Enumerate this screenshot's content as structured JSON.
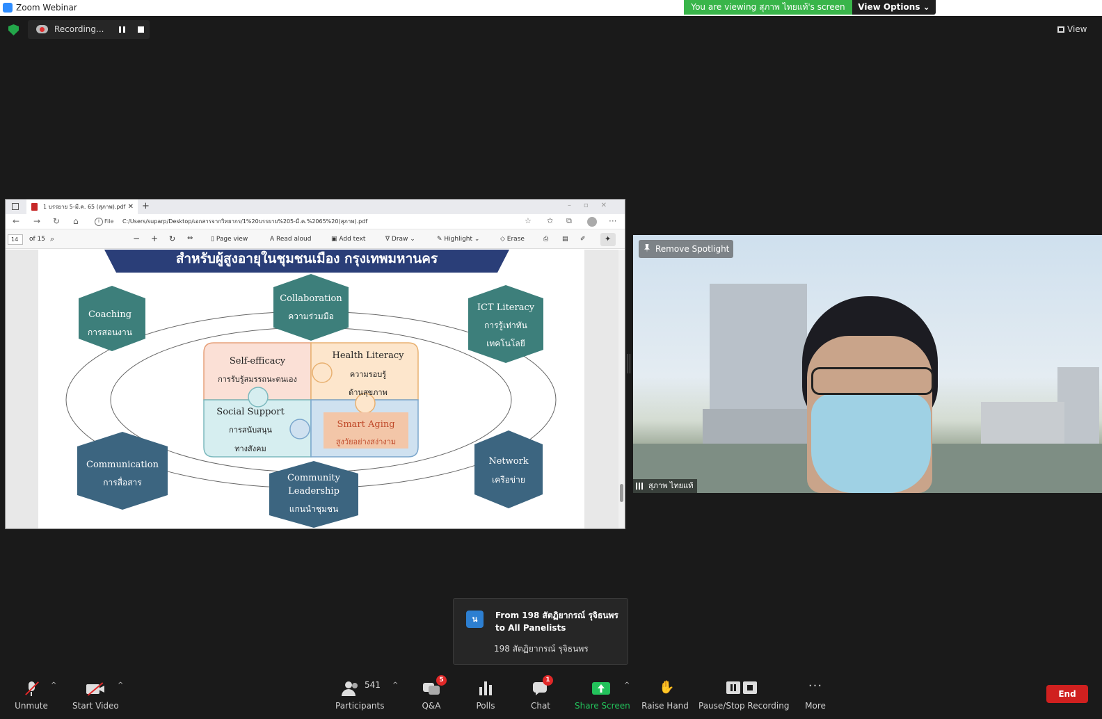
{
  "window": {
    "title": "Zoom Webinar"
  },
  "banner": {
    "viewing": "You are viewing สุภาพ ไทยแท้'s screen",
    "view_options": "View Options ⌄"
  },
  "recording": {
    "label": "Recording..."
  },
  "view_button": {
    "label": "View"
  },
  "browser": {
    "tab_title": "1 บรรยาย 5-มี.ค. 65 (สุภาพ).pdf",
    "file_tag": "File",
    "url": "C:/Users/suparp/Desktop/เอกสารจากวิทยากร/1%20บรรยาย%205-มี.ค.%2065%20(สุภาพ).pdf",
    "page_number": "14",
    "page_total": "of 15",
    "tools": {
      "page_view": "Page view",
      "read_aloud": "Read aloud",
      "add_text": "Add text",
      "draw": "Draw",
      "highlight": "Highlight",
      "erase": "Erase"
    }
  },
  "slide": {
    "heading": "สำหรับผู้สูงอายุในชุมชนเมือง กรุงเทพมหานคร",
    "hexes": [
      {
        "en": "Coaching",
        "th": "การสอนงาน"
      },
      {
        "en": "Collaboration",
        "th": "ความร่วมมือ"
      },
      {
        "en": "ICT Literacy",
        "th": "การรู้เท่าทัน",
        "th2": "เทคโนโลยี"
      },
      {
        "en": "Communication",
        "th": "การสื่อสาร"
      },
      {
        "en": "Community",
        "en2": "Leadership",
        "th": "แกนนำชุมชน"
      },
      {
        "en": "Network",
        "th": "เครือข่าย"
      }
    ],
    "puzzle": {
      "self_efficacy": {
        "en": "Self-efficacy",
        "th": "การรับรู้สมรรถนะตนเอง"
      },
      "health_literacy": {
        "en": "Health Literacy",
        "th": "ความรอบรู้",
        "th2": "ด้านสุขภาพ"
      },
      "social_support": {
        "en": "Social Support",
        "th": "การสนับสนุน",
        "th2": "ทางสังคม"
      },
      "smart_aging": {
        "en": "Smart Aging",
        "th": "สูงวัยอย่างสง่างาม"
      }
    }
  },
  "video": {
    "remove_spotlight": "Remove Spotlight",
    "participant_name": "สุภาพ ไทยแท้"
  },
  "toast": {
    "avatar": "น",
    "from": "From 198 สัตฏิยากรณ์  รุจิธนพร to All Panelists",
    "message": "198 สัตฏิยากรณ์  รุจิธนพร"
  },
  "toolbar": {
    "unmute": "Unmute",
    "start_video": "Start Video",
    "participants": "Participants",
    "participants_count": "541",
    "qa": "Q&A",
    "qa_badge": "5",
    "polls": "Polls",
    "chat": "Chat",
    "chat_badge": "1",
    "share_screen": "Share Screen",
    "raise_hand": "Raise Hand",
    "pause_stop": "Pause/Stop Recording",
    "more": "More",
    "end": "End"
  },
  "colors": {
    "hex_teal": "#3d7f7b",
    "hex_blue": "#3c6580",
    "banner_navy": "#2a3e78",
    "share_green": "#23c25b",
    "end_red": "#d0201f"
  }
}
